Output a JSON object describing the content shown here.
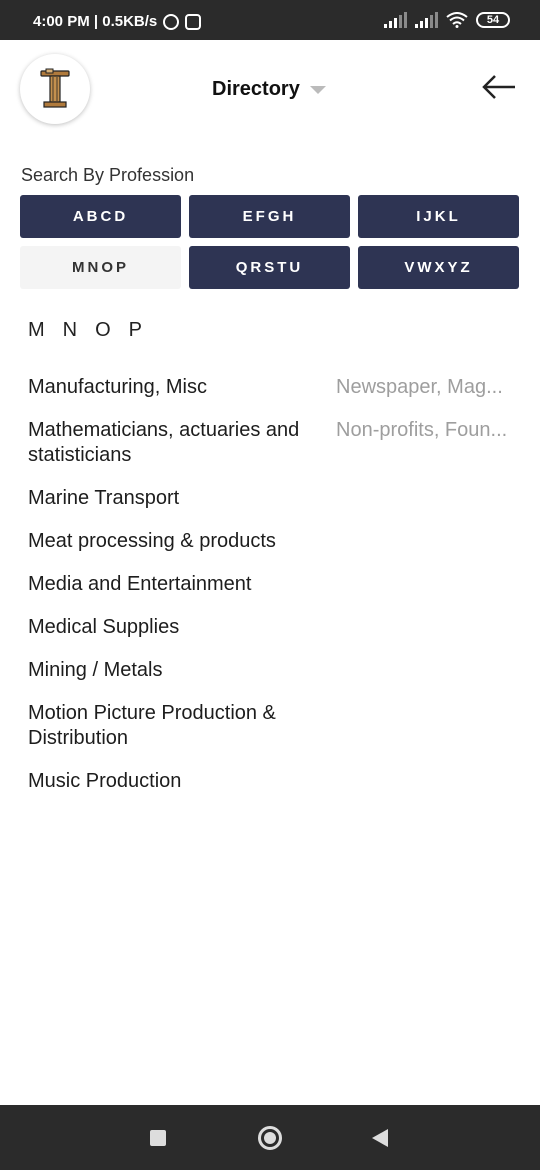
{
  "status_bar": {
    "time_text": "4:00 PM | 0.5KB/s",
    "battery": "54"
  },
  "header": {
    "title": "Directory"
  },
  "search": {
    "label": "Search By Profession",
    "letter_groups": [
      "ABCD",
      "EFGH",
      "IJKL",
      "MNOP",
      "QRSTU",
      "VWXYZ"
    ],
    "selected_group": "MNOP"
  },
  "section": {
    "heading": "MNOP"
  },
  "professions_left": [
    "Manufacturing, Misc",
    "Mathematicians, actuaries and statisticians",
    "Marine Transport",
    "Meat processing & products",
    "Media and Entertainment",
    "Medical Supplies",
    "Mining / Metals",
    "Motion Picture Production & Distribution",
    "Music Production"
  ],
  "professions_right": [
    "Newspaper, Mag...",
    "Non-profits, Foun..."
  ],
  "colors": {
    "button_dark": "#2e3453",
    "button_active": "#f4f4f4",
    "status_bar": "#2b2b2b"
  },
  "icons": {
    "back": "arrow-left-icon",
    "dropdown": "caret-down-icon",
    "logo": "pillar-logo-icon"
  }
}
